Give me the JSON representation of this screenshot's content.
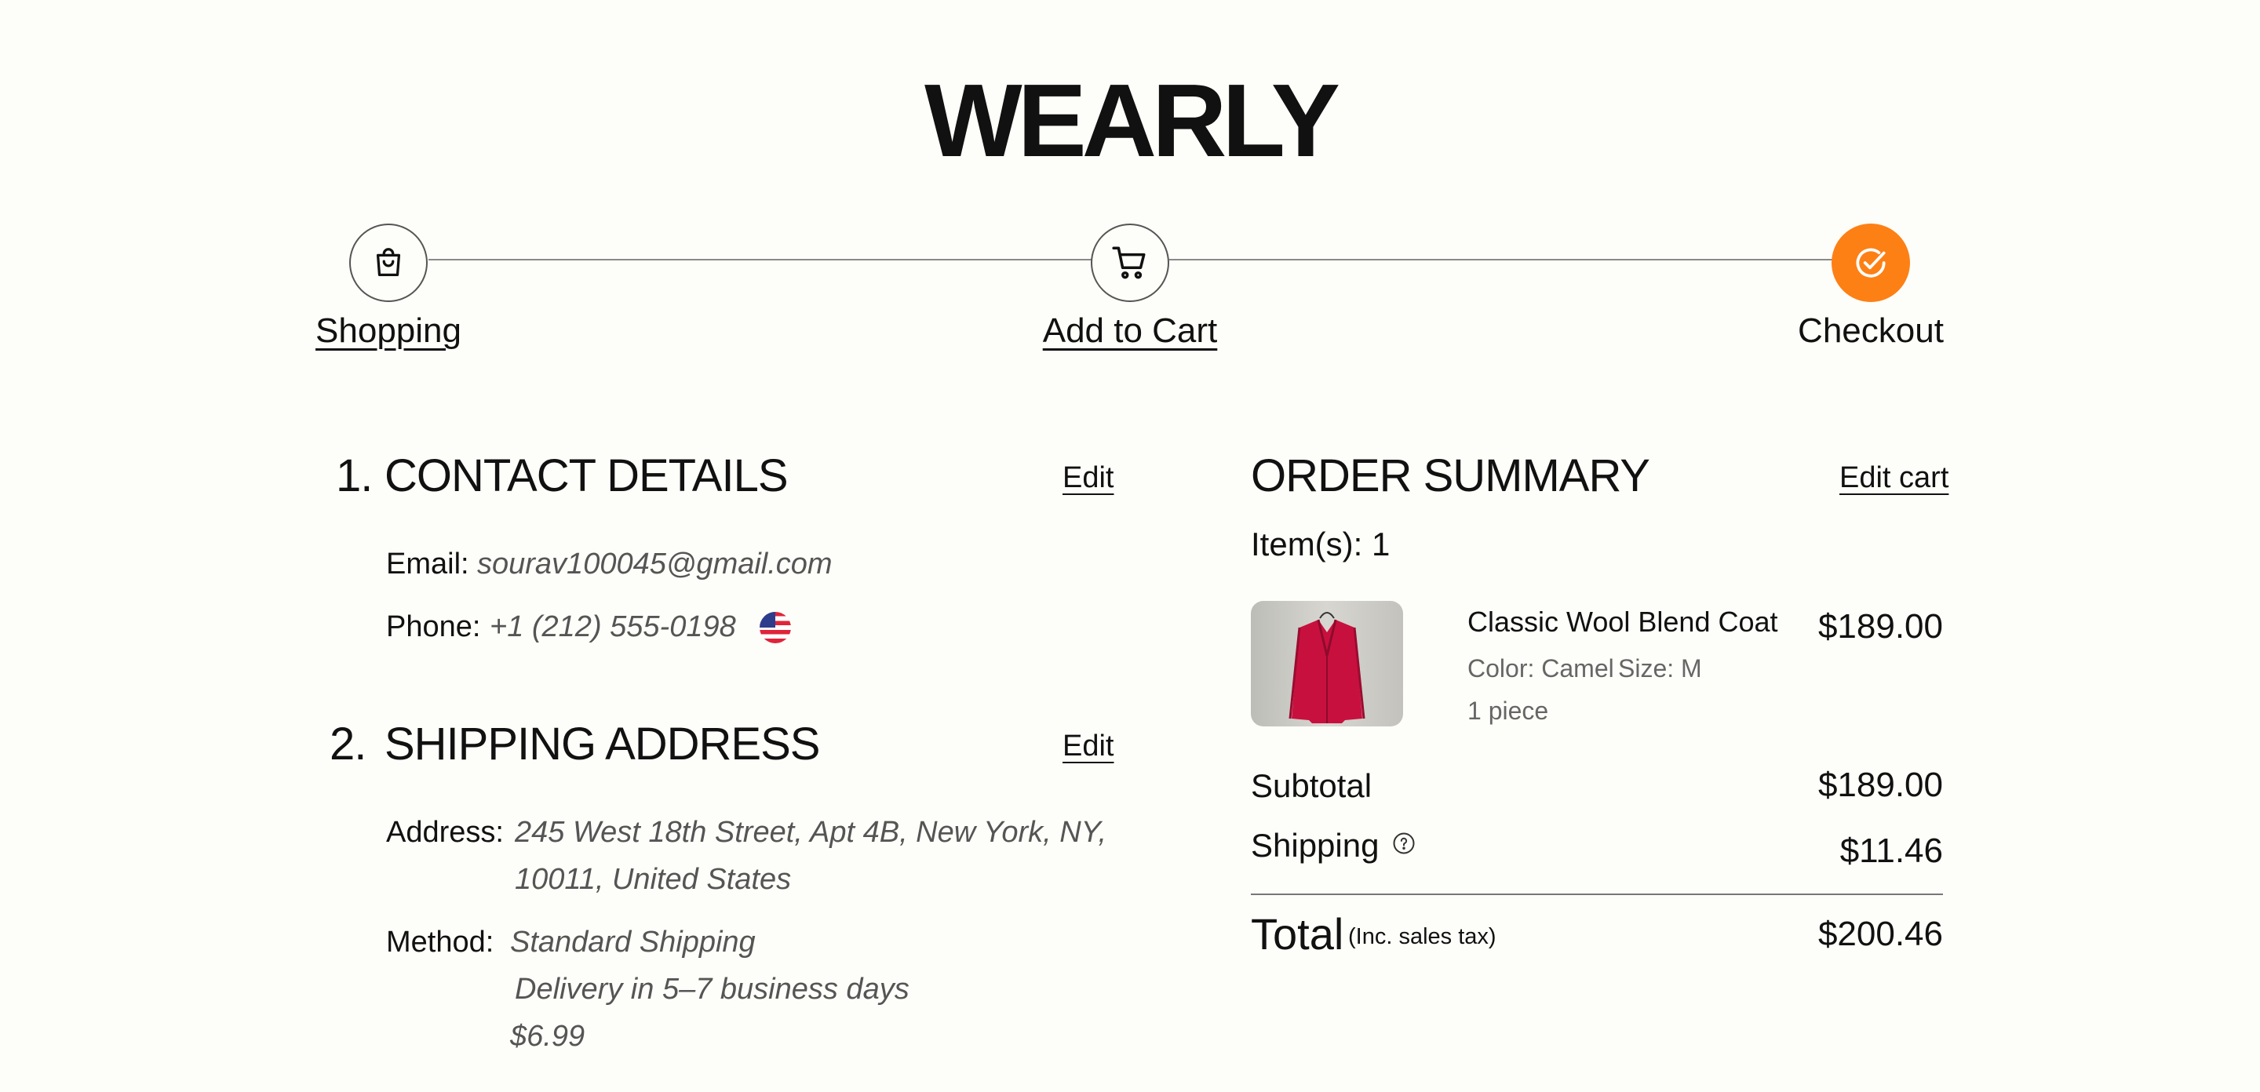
{
  "brand": "WEARLY",
  "steps": [
    {
      "label": "Shopping",
      "icon": "shopping-bag-icon"
    },
    {
      "label": "Add to Cart",
      "icon": "cart-icon"
    },
    {
      "label": "Checkout",
      "icon": "check-circle-icon"
    }
  ],
  "accent_color": "#fd8015",
  "contact": {
    "number": "1.",
    "title": "CONTACT DETAILS",
    "edit_label": "Edit",
    "email_label": "Email:",
    "email_value": "sourav100045@gmail.com",
    "phone_label": "Phone:",
    "phone_value": "+1 (212) 555-0198",
    "phone_flag_icon": "us-flag-icon"
  },
  "shipping": {
    "number": "2.",
    "title": "SHIPPING ADDRESS",
    "edit_label": "Edit",
    "address_label": "Address:",
    "address_line1": "245 West 18th Street, Apt 4B, New York, NY,",
    "address_line2": "10011, United States",
    "method_label": "Method:",
    "method_name": "Standard Shipping",
    "method_delivery": "Delivery in 5–7 business days",
    "method_price": "$6.99"
  },
  "summary": {
    "title": "ORDER SUMMARY",
    "edit_cart_label": "Edit cart",
    "item_count": "Item(s): 1",
    "item": {
      "name": "Classic Wool Blend Coat",
      "color": "Color: Camel",
      "size": "Size: M",
      "qty": "1 piece",
      "price": "$189.00"
    },
    "subtotal_label": "Subtotal",
    "subtotal_value": "$189.00",
    "shipping_label": "Shipping",
    "shipping_value": "$11.46",
    "total_label": "Total",
    "total_note": "(Inc. sales tax)",
    "total_value": "$200.46"
  }
}
